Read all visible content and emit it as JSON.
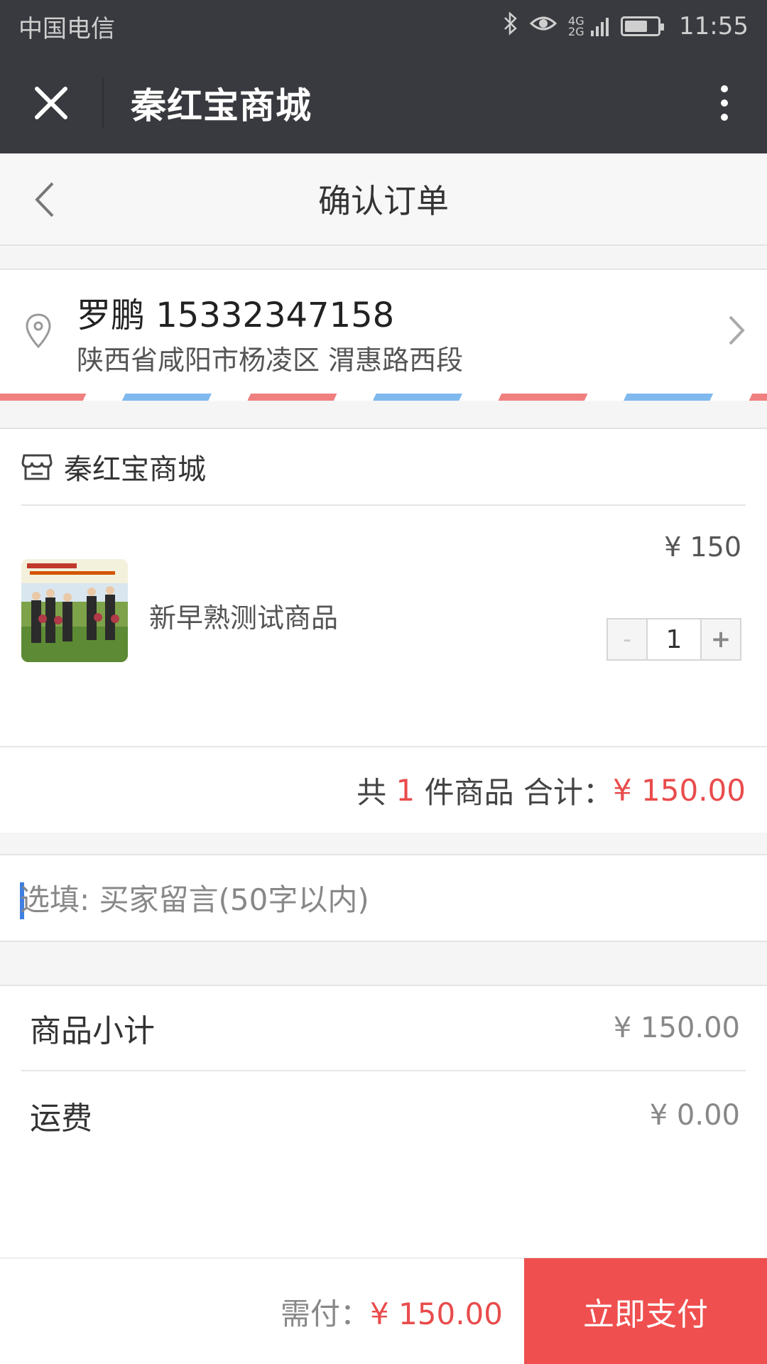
{
  "status_bar": {
    "carrier": "中国电信",
    "network": "4G 2G",
    "time": "11:55",
    "battery_level": 0.7
  },
  "nav": {
    "title": "秦红宝商城"
  },
  "header": {
    "title": "确认订单"
  },
  "address": {
    "name_phone": "罗鹏 15332347158",
    "detail": "陕西省咸阳市杨凌区 渭惠路西段"
  },
  "shop": {
    "name": "秦红宝商城",
    "product": {
      "name": "新早熟测试商品",
      "price": "¥ 150",
      "quantity": "1",
      "minus_label": "-",
      "plus_label": "+"
    },
    "total": {
      "prefix": "共 ",
      "count": "1",
      "middle": " 件商品 合计：",
      "amount": "¥ 150.00"
    }
  },
  "message": {
    "placeholder": "选填: 买家留言(50字以内)"
  },
  "summary": {
    "subtotal_label": "商品小计",
    "subtotal_value": "¥ 150.00",
    "shipping_label": "运费",
    "shipping_value": "¥ 0.00"
  },
  "bottom": {
    "due_label": "需付：",
    "due_amount": "¥ 150.00",
    "pay_button": "立即支付"
  },
  "colors": {
    "accent_red": "#ef4f4f",
    "dark_bar": "#393a3f"
  }
}
